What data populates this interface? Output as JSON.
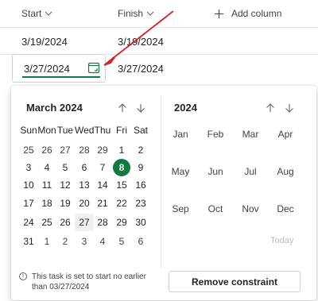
{
  "grid": {
    "columns": {
      "start": "Start",
      "finish": "Finish",
      "add_column": "Add column"
    },
    "rows": [
      {
        "start": "3/19/2024",
        "finish": "3/19/2024"
      },
      {
        "start": "3/27/2024",
        "finish": "3/27/2024"
      }
    ]
  },
  "calendar": {
    "month_title": "March 2024",
    "weekdays": [
      "Sun",
      "Mon",
      "Tue",
      "Wed",
      "Thu",
      "Fri",
      "Sat"
    ],
    "weeks": [
      [
        "25",
        "26",
        "27",
        "28",
        "29",
        "1",
        "2"
      ],
      [
        "3",
        "4",
        "5",
        "6",
        "7",
        "8",
        "9"
      ],
      [
        "10",
        "11",
        "12",
        "13",
        "14",
        "15",
        "16"
      ],
      [
        "17",
        "18",
        "19",
        "20",
        "21",
        "22",
        "23"
      ],
      [
        "24",
        "25",
        "26",
        "27",
        "28",
        "29",
        "30"
      ],
      [
        "31",
        "1",
        "2",
        "3",
        "4",
        "5",
        "6"
      ]
    ],
    "today_day": "8",
    "selected_day": "27",
    "year_title": "2024",
    "months": [
      "Jan",
      "Feb",
      "Mar",
      "Apr",
      "May",
      "Jun",
      "Jul",
      "Aug",
      "Sep",
      "Oct",
      "Nov",
      "Dec"
    ],
    "today_label": "Today",
    "accent_color": "#0f7b3f"
  },
  "constraint": {
    "info_text": "This task is set to start no earlier than 03/27/2024",
    "remove_label": "Remove constraint"
  },
  "annotation": {
    "arrow_color": "#e02020"
  }
}
